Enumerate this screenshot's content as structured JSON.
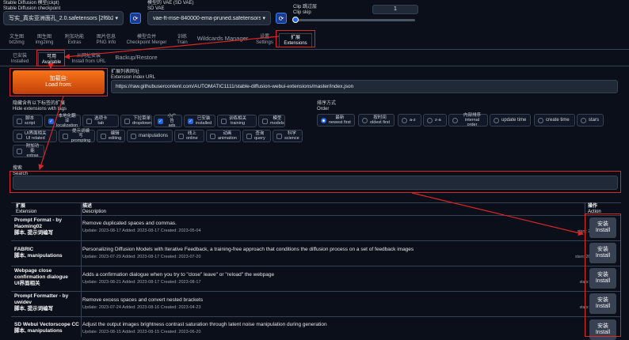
{
  "checkpoint": {
    "label_cn": "Stable Diffusion 模型(ckpt)",
    "label_en": "Stable Diffusion checkpoint",
    "value": "写实_真实亚洲面孔_2.0.safetensors [2f6b20d5"
  },
  "vae": {
    "label_cn": "模型的 VAE (SD VAE)",
    "label_en": "SD VAE",
    "value": "vae-ft-mse-840000-ema-pruned.safetensors"
  },
  "clip": {
    "label_cn": "Clip 跳过层",
    "label_en": "Clip skip",
    "value": "1",
    "slider_fraction": 0.0
  },
  "main_tabs": [
    {
      "cn": "文生图",
      "en": "txt2img"
    },
    {
      "cn": "图生图",
      "en": "img2img"
    },
    {
      "cn": "附加功能",
      "en": "Extras"
    },
    {
      "cn": "图片信息",
      "en": "PNG Info"
    },
    {
      "cn": "模型合并",
      "en": "Checkpoint Merger"
    },
    {
      "cn": "训练",
      "en": "Train"
    },
    {
      "cn": "Wildcards Manager",
      "en": ""
    },
    {
      "cn": "设置",
      "en": "Settings"
    },
    {
      "cn": "扩展",
      "en": "Extensions"
    }
  ],
  "sub_tabs": [
    {
      "cn": "已安装",
      "en": "Installed"
    },
    {
      "cn": "可用",
      "en": "Available"
    },
    {
      "cn": "从网址安装",
      "en": "Install from URL"
    },
    {
      "cn": "Backup/Restore",
      "en": ""
    }
  ],
  "load_button": {
    "cn": "加载自:",
    "en": "Load from:"
  },
  "index_url": {
    "label_cn": "扩展列表网址",
    "label_en": "Extension index URL",
    "value": "https://raw.githubusercontent.com/AUTOMATIC1111/stable-diffusion-webui-extensions/master/index.json"
  },
  "hide_tags": {
    "label_cn": "隐藏含有以下标签的扩展",
    "label_en": "Hide extensions with tags",
    "items": [
      {
        "cn": "脚本",
        "en": "script",
        "checked": false
      },
      {
        "cn": "本地化翻译",
        "en": "localization",
        "checked": true
      },
      {
        "cn": "选项卡",
        "en": "tab",
        "checked": false
      },
      {
        "cn": "下拉菜单",
        "en": "dropdown",
        "checked": false
      },
      {
        "cn": "小广告",
        "en": "ads",
        "checked": true
      },
      {
        "cn": "已安装",
        "en": "installed",
        "checked": true
      },
      {
        "cn": "训练相关",
        "en": "training",
        "checked": false
      },
      {
        "cn": "模型",
        "en": "models",
        "checked": false
      },
      {
        "cn": "UI界面相关",
        "en": "UI related",
        "checked": false
      },
      {
        "cn": "提示词编写",
        "en": "prompting",
        "checked": false
      },
      {
        "cn": "编辑",
        "en": "editing",
        "checked": false
      },
      {
        "cn": "manipulations",
        "en": "",
        "checked": false
      },
      {
        "cn": "线上",
        "en": "online",
        "checked": false
      },
      {
        "cn": "动画",
        "en": "animation",
        "checked": false
      },
      {
        "cn": "查询",
        "en": "query",
        "checked": false
      },
      {
        "cn": "科学",
        "en": "science",
        "checked": false
      },
      {
        "cn": "附加功能",
        "en": "extras",
        "checked": false
      }
    ]
  },
  "order": {
    "label_cn": "排序方式",
    "label_en": "Order",
    "items": [
      {
        "cn": "最新",
        "en": "newest first",
        "selected": true
      },
      {
        "cn": "按时间",
        "en": "oldest first",
        "selected": false
      },
      {
        "cn": "a-z",
        "en": "",
        "selected": false
      },
      {
        "cn": "z-a",
        "en": "",
        "selected": false
      },
      {
        "cn": "内部排序",
        "en": "internal order",
        "selected": false
      },
      {
        "cn": "update time",
        "en": "",
        "selected": false
      },
      {
        "cn": "create time",
        "en": "",
        "selected": false
      },
      {
        "cn": "stars",
        "en": "",
        "selected": false
      }
    ]
  },
  "search": {
    "label_cn": "搜索",
    "label_en": "Search",
    "value": ""
  },
  "table": {
    "headers": {
      "ext_cn": "扩展",
      "ext_en": "Extension",
      "desc_cn": "描述",
      "desc_en": "Description",
      "act_cn": "操作",
      "act_en": "Action"
    },
    "rows": [
      {
        "name": "Prompt Format - by Haoming02",
        "tags": "脚本, 提示词编写",
        "desc": "Remove duplicated spaces and commas.",
        "meta": "Update: 2023-08-17 Added: 2023-08-17 Created: 2023-05-04",
        "stars": "stars: 25",
        "btn_cn": "安装",
        "btn_en": "Install"
      },
      {
        "name": "FABRIC",
        "tags": "脚本, manipulations",
        "desc": "Personalizing Diffusion Models with Iterative Feedback, a training-free approach that conditions the diffusion process on a set of feedback images",
        "meta": "Update: 2023-07-29 Added: 2023-08-17 Created: 2023-07-20",
        "stars": "stars: 269",
        "btn_cn": "安装",
        "btn_en": "Install"
      },
      {
        "name": "Webpage close confirmation dialogue",
        "tags": "UI界面相关",
        "desc": "Adds a confirmation dialogue when you try to \"close\" leave\" or \"reload\" the webpage",
        "meta": "Update: 2023-08-21 Added: 2023-08-17 Created: 2023-08-17",
        "stars": "stars: 1",
        "btn_cn": "安装",
        "btn_en": "Install"
      },
      {
        "name": "Prompt Formatter - by uwidev",
        "tags": "脚本, 提示词编写",
        "desc": "Remove excess spaces and convert nested brackets",
        "meta": "Update: 2023-07-24 Added: 2023-08-16 Created: 2023-04-23",
        "stars": "stars: 7",
        "btn_cn": "安装",
        "btn_en": "Install"
      },
      {
        "name": "SD Webui Vectorscope CC",
        "tags": "脚本, manipulations",
        "desc": "Adjust the output images brightness contrast saturation through latent noise manipulation during generation",
        "meta": "Update: 2023-08-15 Added: 2023-08-15 Created: 2023-06-20",
        "stars": "",
        "btn_cn": "安装",
        "btn_en": "Install"
      }
    ]
  },
  "colors": {
    "background": "#0b0f19",
    "accent_orange": "#ea580c",
    "annotation_red": "#dc2626",
    "checkbox_blue": "#2563eb"
  }
}
